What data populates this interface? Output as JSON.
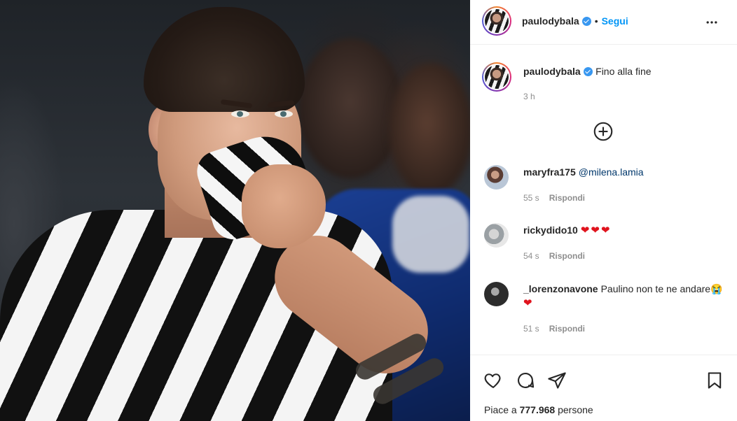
{
  "post": {
    "photo_alt": "Dybala in Juventus jersey covering his face",
    "author": "paulodybala",
    "follow_label": "Segui",
    "separator": "•",
    "caption": "Fino alla fine",
    "time": "3 h",
    "likes_prefix": "Piace a",
    "likes_count": "777.968",
    "likes_suffix": "persone"
  },
  "comments": [
    {
      "user": "maryfra175",
      "mention": "@milena.lamia",
      "text": "",
      "hearts": "",
      "time": "55 s",
      "reply_label": "Rispondi"
    },
    {
      "user": "rickydido10",
      "mention": "",
      "text": "",
      "hearts": "❤❤❤",
      "time": "54 s",
      "reply_label": "Rispondi"
    },
    {
      "user": "_lorenzonavone",
      "mention": "",
      "text": "Paulino non te ne andare😭",
      "hearts": "❤",
      "time": "51 s",
      "reply_label": "Rispondi"
    }
  ],
  "icons": {
    "more": "more-options-icon",
    "load_more": "plus-circle-icon",
    "like": "heart-icon",
    "comment": "comment-bubble-icon",
    "share": "paper-plane-icon",
    "save": "bookmark-icon",
    "verified": "verified-badge-icon"
  },
  "colors": {
    "link_blue": "#0095f6",
    "verified_blue": "#3897f0",
    "heart_red": "#e0141e",
    "muted": "#8e8e8e",
    "text": "#262626"
  }
}
